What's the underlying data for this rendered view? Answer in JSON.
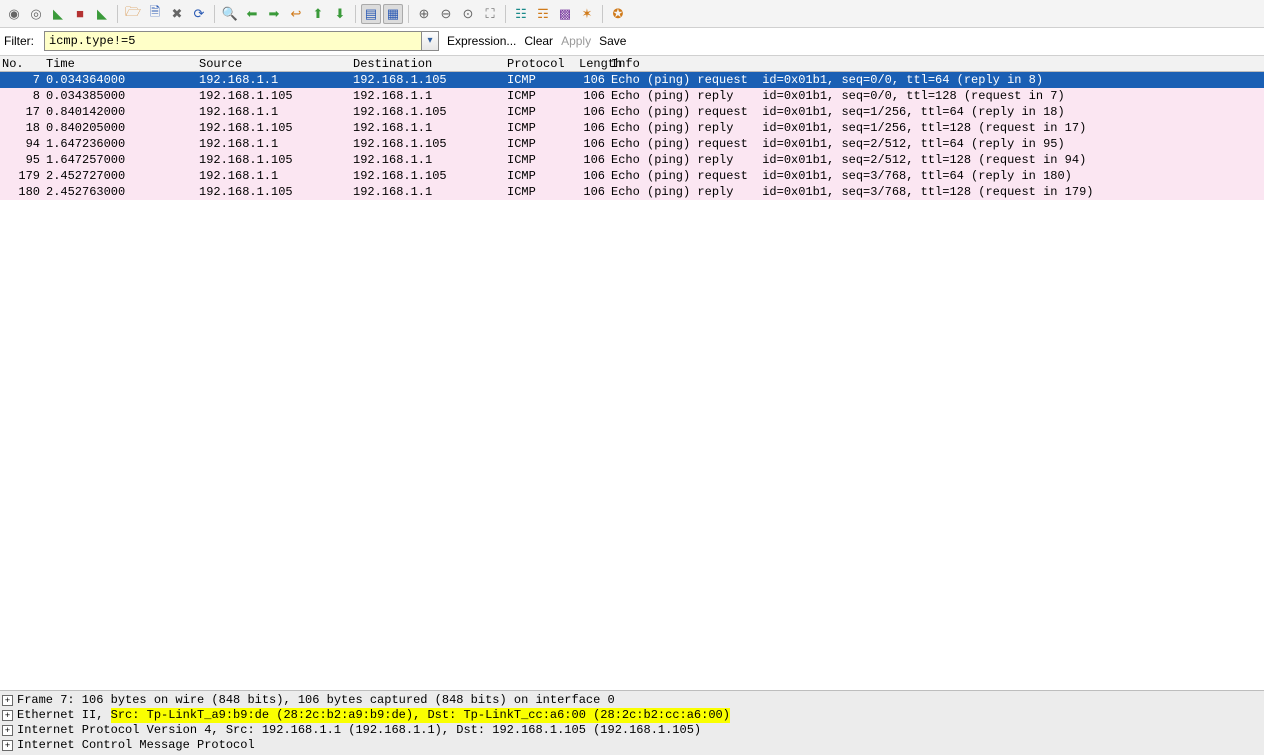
{
  "toolbar_icons": [
    {
      "name": "capture-interfaces-icon",
      "glyph": "◉",
      "cls": "ic-gray"
    },
    {
      "name": "capture-options-icon",
      "glyph": "◎",
      "cls": "ic-gray"
    },
    {
      "name": "capture-start-icon",
      "glyph": "◣",
      "cls": "ic-green"
    },
    {
      "name": "capture-stop-icon",
      "glyph": "■",
      "cls": "ic-red"
    },
    {
      "name": "capture-restart-icon",
      "glyph": "◣",
      "cls": "ic-green"
    },
    {
      "sep": true
    },
    {
      "name": "file-open-icon",
      "glyph": "🗁",
      "cls": "ic-orange"
    },
    {
      "name": "file-save-icon",
      "glyph": "🗎",
      "cls": "ic-blue"
    },
    {
      "name": "file-close-icon",
      "glyph": "✖",
      "cls": "ic-gray"
    },
    {
      "name": "reload-icon",
      "glyph": "⟳",
      "cls": "ic-blue"
    },
    {
      "sep": true
    },
    {
      "name": "find-icon",
      "glyph": "🔍",
      "cls": "ic-gray"
    },
    {
      "name": "go-back-icon",
      "glyph": "⬅",
      "cls": "ic-green"
    },
    {
      "name": "go-forward-icon",
      "glyph": "➡",
      "cls": "ic-green"
    },
    {
      "name": "go-jump-icon",
      "glyph": "↩",
      "cls": "ic-orange"
    },
    {
      "name": "go-first-icon",
      "glyph": "⬆",
      "cls": "ic-green"
    },
    {
      "name": "go-last-icon",
      "glyph": "⬇",
      "cls": "ic-green"
    },
    {
      "sep": true
    },
    {
      "name": "colorize-icon",
      "glyph": "▤",
      "cls": "ic-blue",
      "pressed": true
    },
    {
      "name": "auto-scroll-icon",
      "glyph": "▦",
      "cls": "ic-blue",
      "pressed": true
    },
    {
      "sep": true
    },
    {
      "name": "zoom-in-icon",
      "glyph": "⊕",
      "cls": "ic-gray"
    },
    {
      "name": "zoom-out-icon",
      "glyph": "⊖",
      "cls": "ic-gray"
    },
    {
      "name": "zoom-reset-icon",
      "glyph": "⊙",
      "cls": "ic-gray"
    },
    {
      "name": "resize-columns-icon",
      "glyph": "⛶",
      "cls": "ic-gray"
    },
    {
      "sep": true
    },
    {
      "name": "capture-filters-icon",
      "glyph": "☷",
      "cls": "ic-teal"
    },
    {
      "name": "display-filters-icon",
      "glyph": "☶",
      "cls": "ic-orange"
    },
    {
      "name": "coloring-rules-icon",
      "glyph": "▩",
      "cls": "ic-purple"
    },
    {
      "name": "preferences-icon",
      "glyph": "✶",
      "cls": "ic-orange"
    },
    {
      "sep": true
    },
    {
      "name": "help-icon",
      "glyph": "✪",
      "cls": "ic-orange"
    }
  ],
  "filter": {
    "label": "Filter:",
    "value": "icmp.type!=5",
    "expression": "Expression...",
    "clear": "Clear",
    "apply": "Apply",
    "save": "Save"
  },
  "columns": {
    "no": "No.",
    "time": "Time",
    "source": "Source",
    "destination": "Destination",
    "protocol": "Protocol",
    "length": "Length",
    "info": "Info"
  },
  "packets": [
    {
      "no": "7",
      "time": "0.034364000",
      "src": "192.168.1.1",
      "dst": "192.168.1.105",
      "proto": "ICMP",
      "len": "106",
      "info": "Echo (ping) request  id=0x01b1, seq=0/0, ttl=64 (reply in 8)",
      "selected": true
    },
    {
      "no": "8",
      "time": "0.034385000",
      "src": "192.168.1.105",
      "dst": "192.168.1.1",
      "proto": "ICMP",
      "len": "106",
      "info": "Echo (ping) reply    id=0x01b1, seq=0/0, ttl=128 (request in 7)"
    },
    {
      "no": "17",
      "time": "0.840142000",
      "src": "192.168.1.1",
      "dst": "192.168.1.105",
      "proto": "ICMP",
      "len": "106",
      "info": "Echo (ping) request  id=0x01b1, seq=1/256, ttl=64 (reply in 18)"
    },
    {
      "no": "18",
      "time": "0.840205000",
      "src": "192.168.1.105",
      "dst": "192.168.1.1",
      "proto": "ICMP",
      "len": "106",
      "info": "Echo (ping) reply    id=0x01b1, seq=1/256, ttl=128 (request in 17)"
    },
    {
      "no": "94",
      "time": "1.647236000",
      "src": "192.168.1.1",
      "dst": "192.168.1.105",
      "proto": "ICMP",
      "len": "106",
      "info": "Echo (ping) request  id=0x01b1, seq=2/512, ttl=64 (reply in 95)"
    },
    {
      "no": "95",
      "time": "1.647257000",
      "src": "192.168.1.105",
      "dst": "192.168.1.1",
      "proto": "ICMP",
      "len": "106",
      "info": "Echo (ping) reply    id=0x01b1, seq=2/512, ttl=128 (request in 94)"
    },
    {
      "no": "179",
      "time": "2.452727000",
      "src": "192.168.1.1",
      "dst": "192.168.1.105",
      "proto": "ICMP",
      "len": "106",
      "info": "Echo (ping) request  id=0x01b1, seq=3/768, ttl=64 (reply in 180)"
    },
    {
      "no": "180",
      "time": "2.452763000",
      "src": "192.168.1.105",
      "dst": "192.168.1.1",
      "proto": "ICMP",
      "len": "106",
      "info": "Echo (ping) reply    id=0x01b1, seq=3/768, ttl=128 (request in 179)"
    }
  ],
  "details": {
    "frame": "Frame 7: 106 bytes on wire (848 bits), 106 bytes captured (848 bits) on interface 0",
    "eth_prefix": "Ethernet II, ",
    "eth_highlight": "Src: Tp-LinkT_a9:b9:de (28:2c:b2:a9:b9:de), Dst: Tp-LinkT_cc:a6:00 (28:2c:b2:cc:a6:00)",
    "ip": "Internet Protocol Version 4, Src: 192.168.1.1 (192.168.1.1), Dst: 192.168.1.105 (192.168.1.105)",
    "icmp": "Internet Control Message Protocol"
  }
}
